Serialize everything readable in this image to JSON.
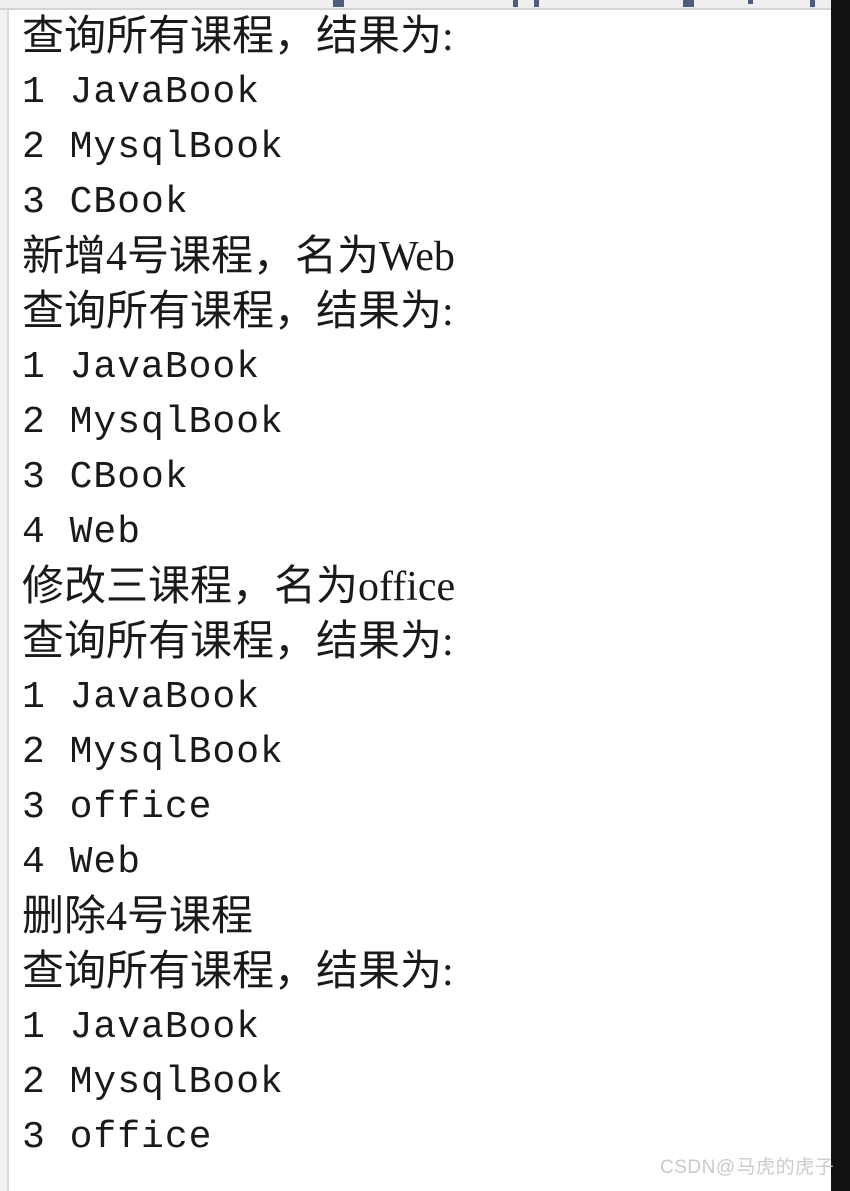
{
  "window": {
    "kind": "console-output-pane",
    "background_color": "#ffffff",
    "text_color": "#1a1a1a",
    "gutter_color": "#f2f2f2",
    "right_band_color": "#121212"
  },
  "console": {
    "lines": [
      {
        "text": "查询所有课程，结果为:",
        "script": "cjk"
      },
      {
        "text": "1 JavaBook",
        "script": "mono"
      },
      {
        "text": "2 MysqlBook",
        "script": "mono"
      },
      {
        "text": "3 CBook",
        "script": "mono"
      },
      {
        "text": "新增4号课程，名为Web",
        "script": "cjk"
      },
      {
        "text": "查询所有课程，结果为:",
        "script": "cjk"
      },
      {
        "text": "1 JavaBook",
        "script": "mono"
      },
      {
        "text": "2 MysqlBook",
        "script": "mono"
      },
      {
        "text": "3 CBook",
        "script": "mono"
      },
      {
        "text": "4 Web",
        "script": "mono"
      },
      {
        "text": "修改三课程，名为office",
        "script": "cjk"
      },
      {
        "text": "查询所有课程，结果为:",
        "script": "cjk"
      },
      {
        "text": "1 JavaBook",
        "script": "mono"
      },
      {
        "text": "2 MysqlBook",
        "script": "mono"
      },
      {
        "text": "3 office",
        "script": "mono"
      },
      {
        "text": "4 Web",
        "script": "mono"
      },
      {
        "text": "删除4号课程",
        "script": "cjk"
      },
      {
        "text": "查询所有课程，结果为:",
        "script": "cjk"
      },
      {
        "text": "1 JavaBook",
        "script": "mono"
      },
      {
        "text": "2 MysqlBook",
        "script": "mono"
      },
      {
        "text": "3 office",
        "script": "mono"
      }
    ]
  },
  "watermark": {
    "brand": "CSDN",
    "separator": "@",
    "user": "马虎的虎子"
  }
}
